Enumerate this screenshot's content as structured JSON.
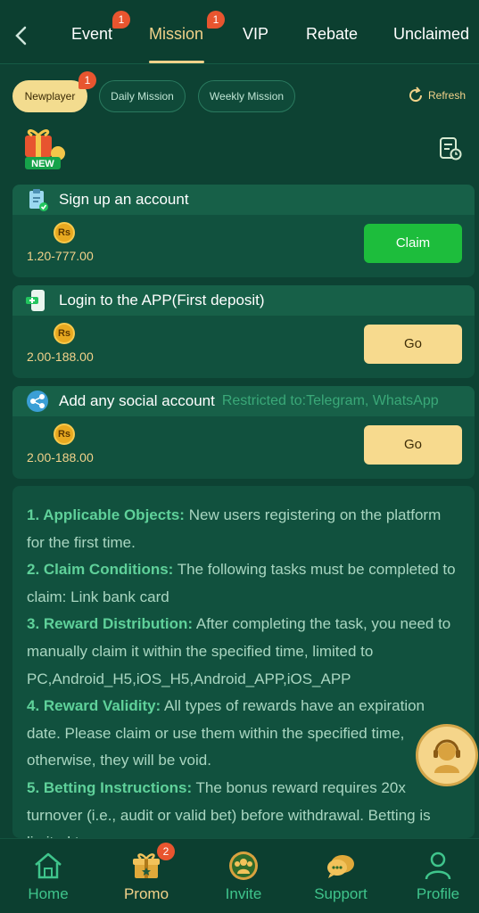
{
  "header": {
    "tabs": [
      {
        "label": "Event",
        "badge": "1"
      },
      {
        "label": "Mission",
        "badge": "1",
        "active": true
      },
      {
        "label": "VIP"
      },
      {
        "label": "Rebate"
      },
      {
        "label": "Unclaimed"
      }
    ]
  },
  "subtabs": {
    "items": [
      {
        "label": "Newplayer",
        "badge": "1",
        "active": true
      },
      {
        "label": "Daily Mission"
      },
      {
        "label": "Weekly Mission"
      }
    ],
    "refresh_label": "Refresh"
  },
  "new_badge_text": "NEW",
  "tasks": [
    {
      "title": "Sign up an account",
      "currency": "Rs",
      "amount": "1.20-777.00",
      "button": "Claim"
    },
    {
      "title": "Login to the APP(First deposit)",
      "currency": "Rs",
      "amount": "2.00-188.00",
      "button": "Go"
    },
    {
      "title": "Add any social account",
      "restriction": "Restricted to:Telegram, WhatsApp",
      "currency": "Rs",
      "amount": "2.00-188.00",
      "button": "Go"
    }
  ],
  "rules": [
    {
      "heading": "1. Applicable Objects:",
      "text": " New users registering on the platform for the first time."
    },
    {
      "heading": "2. Claim Conditions:",
      "text": " The following tasks must be completed to claim: Link bank card"
    },
    {
      "heading": "3. Reward Distribution:",
      "text": " After completing the task, you need to manually claim it within the specified time, limited to PC,Android_H5,iOS_H5,Android_APP,iOS_APP"
    },
    {
      "heading": "4. Reward Validity:",
      "text": " All types of rewards have an expiration date. Please claim or use them within the specified time, otherwise, they will be void."
    },
    {
      "heading": "5. Betting Instructions:",
      "text": " The bonus reward requires 20x turnover (i.e., audit or valid bet) before withdrawal. Betting is limited to :"
    }
  ],
  "bottom_nav": {
    "items": [
      {
        "label": "Home"
      },
      {
        "label": "Promo",
        "badge": "2",
        "active": true
      },
      {
        "label": "Invite"
      },
      {
        "label": "Support"
      },
      {
        "label": "Profile"
      }
    ]
  },
  "colors": {
    "background": "#0d4233",
    "accent_gold": "#f2d28a",
    "claim_green": "#1dbd3c",
    "badge_red": "#e8552f"
  }
}
